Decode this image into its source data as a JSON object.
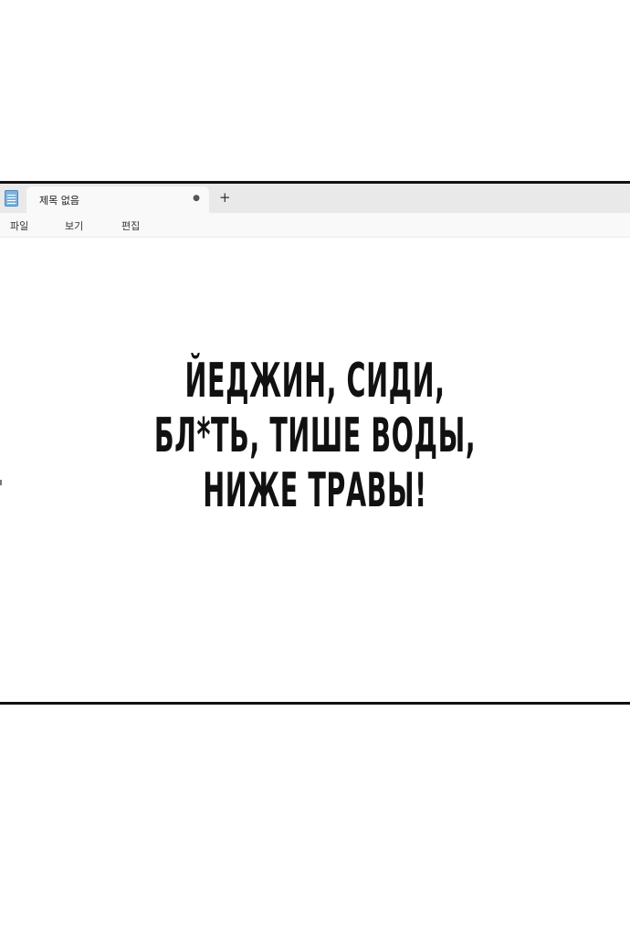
{
  "window": {
    "tab_title": "제목 없음",
    "close_symbol": "●",
    "new_tab_symbol": "+",
    "app_icon": "notepad-icon"
  },
  "menu": {
    "items": [
      "파일",
      "보기",
      "편집"
    ]
  },
  "content": {
    "lines": [
      "ЙЕДЖИН, СИДИ,",
      "БЛ*ТЬ, ТИШЕ ВОДЫ,",
      "НИЖЕ ТРАВЫ!"
    ]
  },
  "colors": {
    "border": "#111111",
    "tabbar": "#e9e9e9",
    "active_tab": "#f9f9f9",
    "text": "#111111"
  }
}
